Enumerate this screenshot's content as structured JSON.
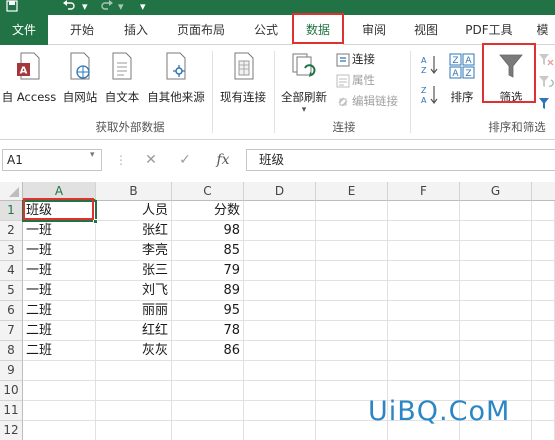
{
  "quick_access": {
    "undo_icon": "undo-icon",
    "redo_icon": "redo-icon",
    "customize_icon": "customize-icon"
  },
  "tabs": [
    {
      "label": "文件"
    },
    {
      "label": "开始"
    },
    {
      "label": "插入"
    },
    {
      "label": "页面布局"
    },
    {
      "label": "公式"
    },
    {
      "label": "数据"
    },
    {
      "label": "审阅"
    },
    {
      "label": "视图"
    },
    {
      "label": "PDF工具"
    },
    {
      "label": "模"
    }
  ],
  "active_tab": "数据",
  "ribbon": {
    "get_external": {
      "group_label": "获取外部数据",
      "from_access": "自 Access",
      "from_web": "自网站",
      "from_text": "自文本",
      "from_other": "自其他来源",
      "existing": "现有连接"
    },
    "connections": {
      "group_label": "连接",
      "refresh_all": "全部刷新",
      "connections": "连接",
      "properties": "属性",
      "edit_links": "编辑链接"
    },
    "sort_filter": {
      "group_label": "排序和筛选",
      "sort": "排序",
      "filter": "筛选"
    }
  },
  "formula_bar": {
    "name_box": "A1",
    "cancel": "✕",
    "enter": "✓",
    "fx": "fx",
    "content": "班级"
  },
  "columns": [
    "A",
    "B",
    "C",
    "D",
    "E",
    "F",
    "G"
  ],
  "rows": [
    "1",
    "2",
    "3",
    "4",
    "5",
    "6",
    "7",
    "8",
    "9",
    "10",
    "11",
    "12"
  ],
  "table": {
    "headers": [
      "班级",
      "人员",
      "分数"
    ],
    "records": [
      [
        "一班",
        "张红",
        "98"
      ],
      [
        "一班",
        "李亮",
        "85"
      ],
      [
        "一班",
        "张三",
        "79"
      ],
      [
        "一班",
        "刘飞",
        "89"
      ],
      [
        "二班",
        "丽丽",
        "95"
      ],
      [
        "二班",
        "红红",
        "78"
      ],
      [
        "二班",
        "灰灰",
        "86"
      ]
    ]
  },
  "watermark": "UiBQ.CoM",
  "colors": {
    "accent": "#217346",
    "highlight": "#e03131",
    "watermark": "#2b86c5"
  }
}
